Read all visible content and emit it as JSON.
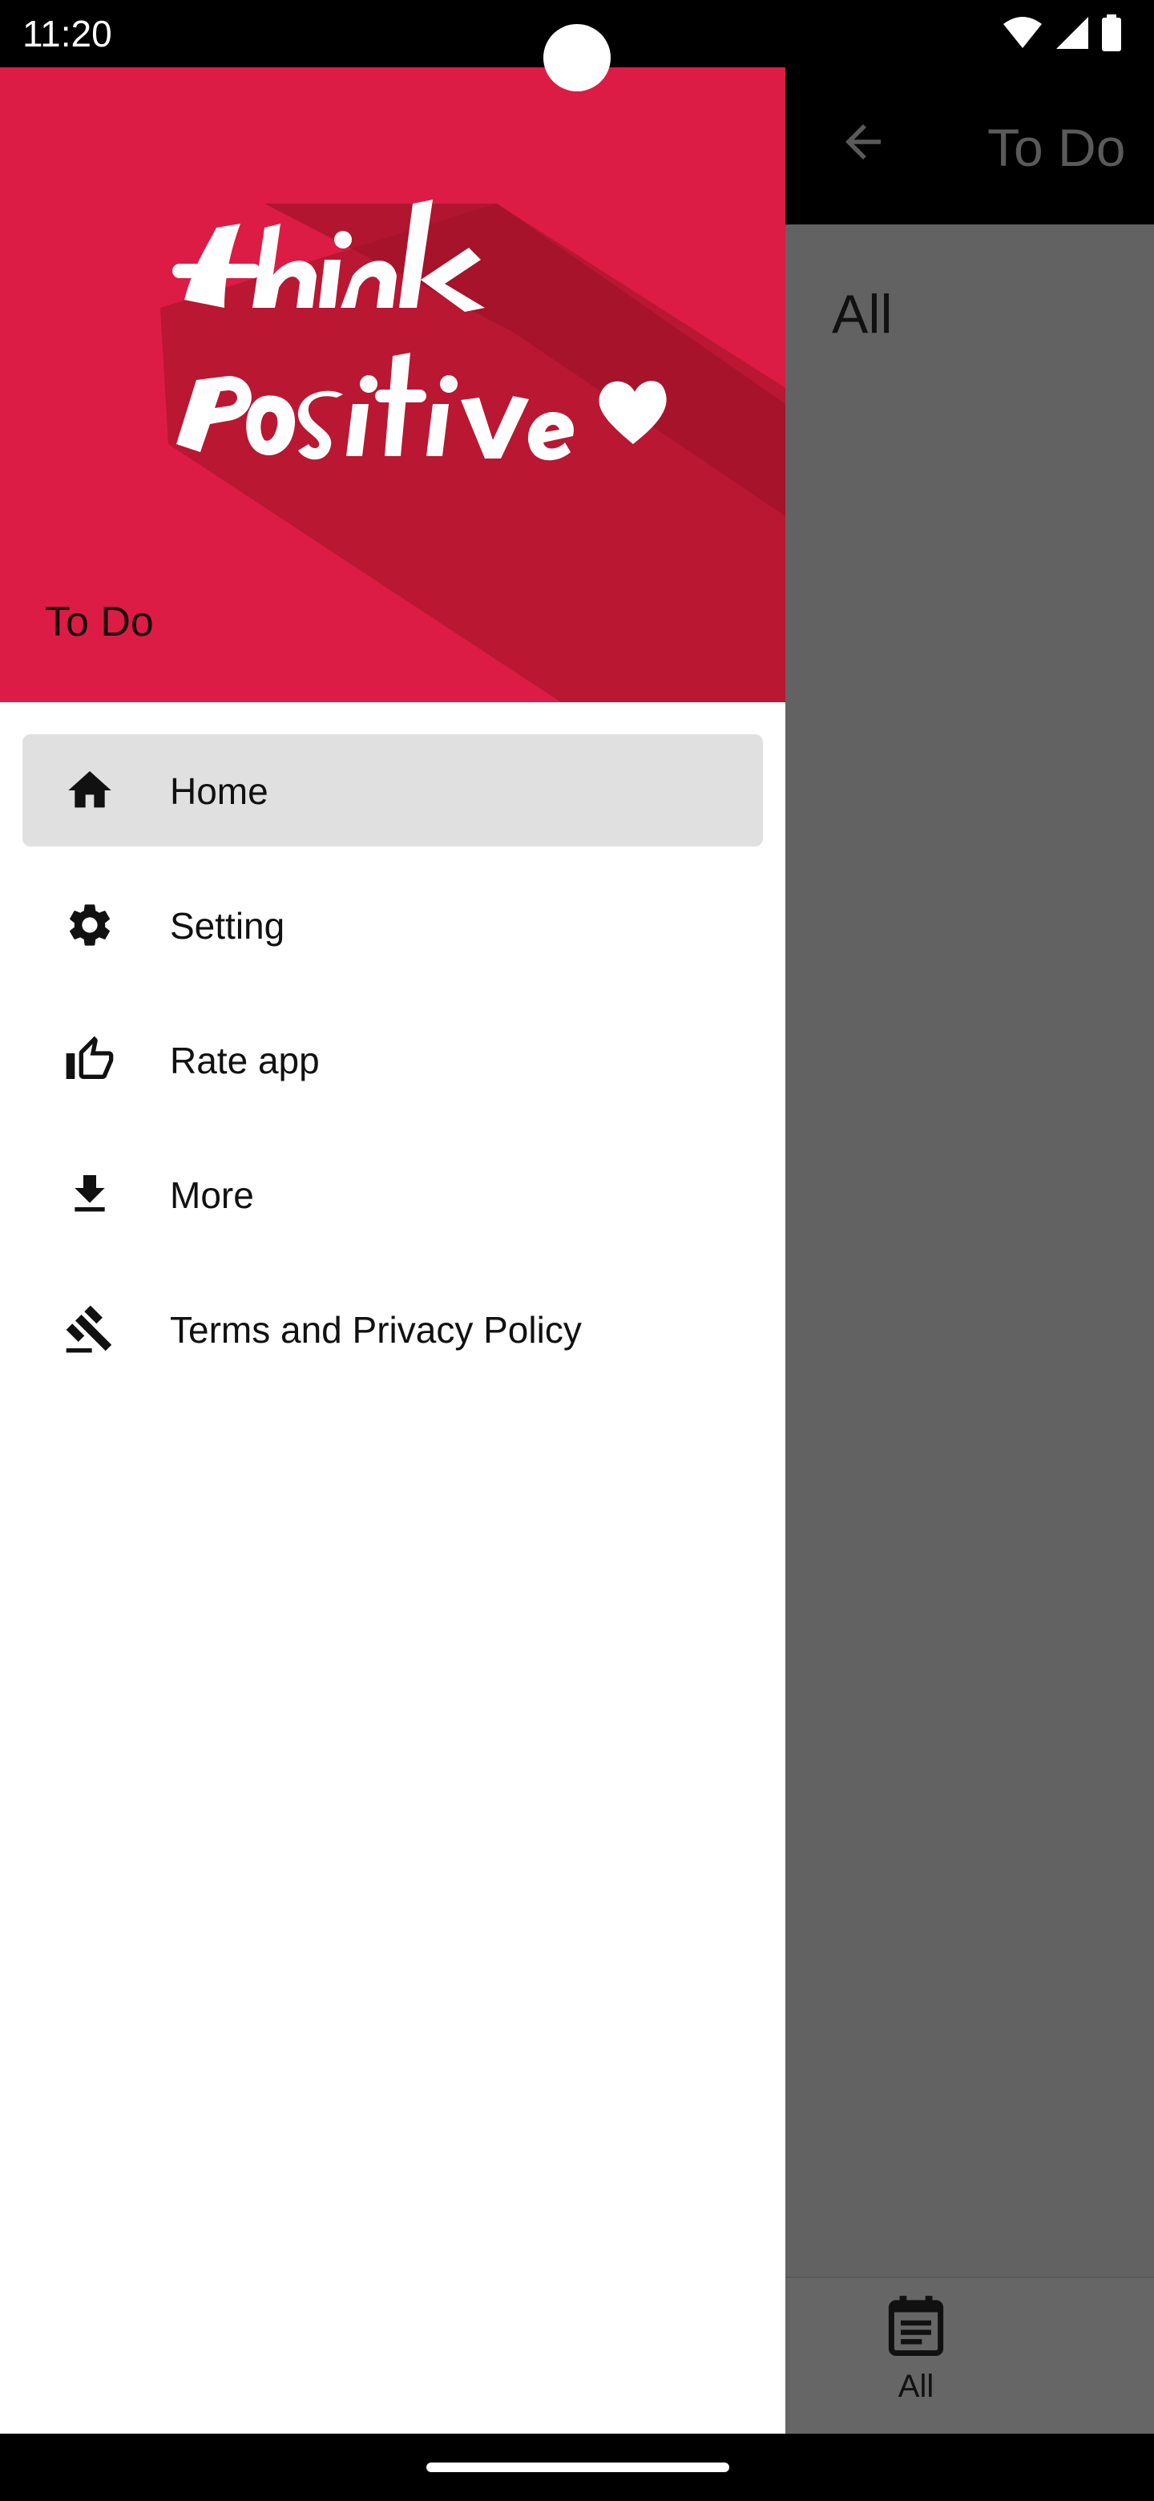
{
  "status_bar": {
    "time": "11:20"
  },
  "app": {
    "title": "To Do",
    "filter_label": "All",
    "bottom_nav": {
      "all_label": "All"
    }
  },
  "drawer": {
    "header_title": "To Do",
    "header_image": "think-positive-logo",
    "header_color": "#dc1c44",
    "items": [
      {
        "label": "Home",
        "icon": "home-icon",
        "active": true
      },
      {
        "label": "Setting",
        "icon": "gear-icon",
        "active": false
      },
      {
        "label": "Rate app",
        "icon": "thumbs-up-icon",
        "active": false
      },
      {
        "label": "More",
        "icon": "download-icon",
        "active": false
      },
      {
        "label": "Terms and Privacy Policy",
        "icon": "gavel-icon",
        "active": false
      }
    ]
  }
}
